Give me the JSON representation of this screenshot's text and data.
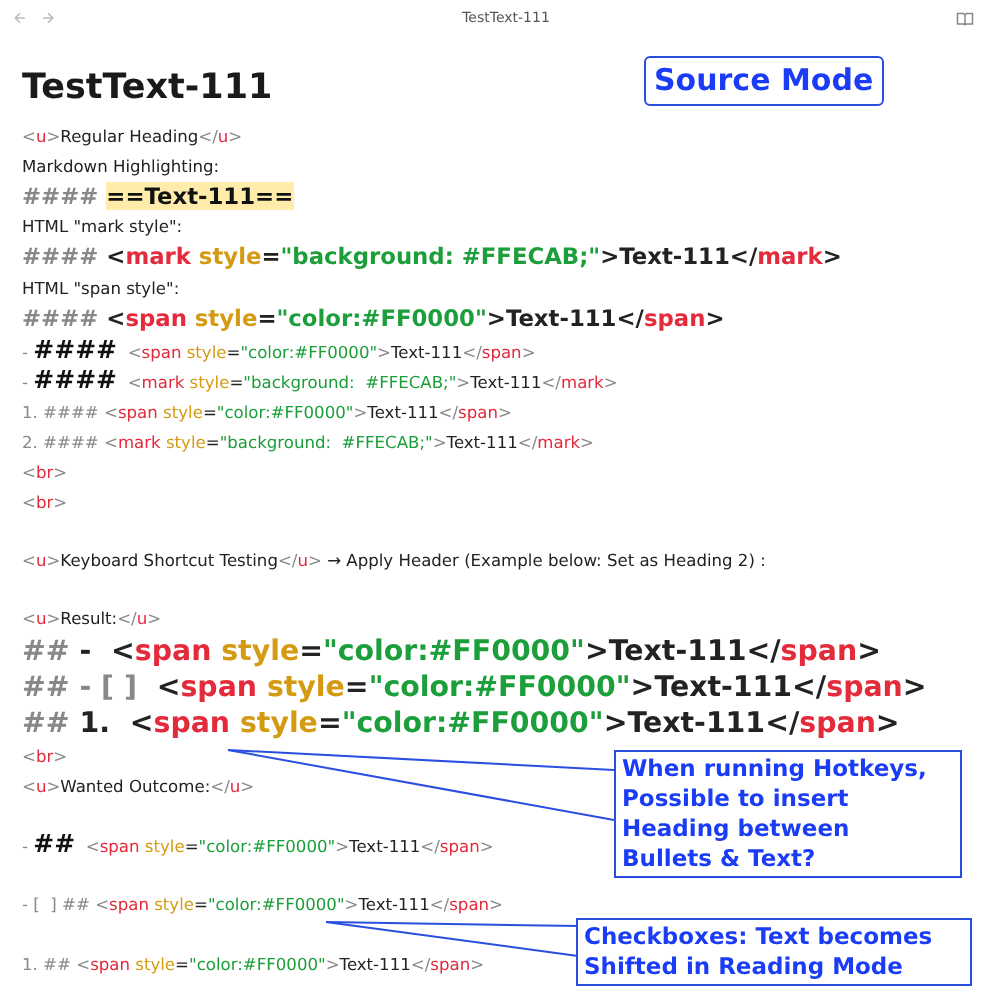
{
  "window": {
    "title": "TestText-111"
  },
  "document": {
    "title": "TestText-111",
    "lines": [
      {
        "kind": "body",
        "space_before": false,
        "tokens": [
          {
            "kind": "punct",
            "text": "<"
          },
          {
            "kind": "tag",
            "text": "u"
          },
          {
            "kind": "punct",
            "text": ">"
          },
          {
            "kind": "text",
            "text": "Regular Heading"
          },
          {
            "kind": "punct",
            "text": "</"
          },
          {
            "kind": "tag",
            "text": "u"
          },
          {
            "kind": "punct",
            "text": ">"
          }
        ]
      },
      {
        "kind": "body",
        "space_before": false,
        "tokens": [
          {
            "kind": "text",
            "text": "Markdown Highlighting:"
          }
        ]
      },
      {
        "kind": "h4",
        "space_before": false,
        "tokens": [
          {
            "kind": "hash",
            "text": "#### "
          },
          {
            "kind": "highlight",
            "text": "==Text-111=="
          }
        ]
      },
      {
        "kind": "body",
        "space_before": false,
        "tokens": [
          {
            "kind": "text",
            "text": "HTML \"mark style\":"
          }
        ]
      },
      {
        "kind": "h4",
        "space_before": false,
        "tokens": [
          {
            "kind": "hash",
            "text": "#### "
          },
          {
            "kind": "punct",
            "text": "<"
          },
          {
            "kind": "tag",
            "text": "mark"
          },
          {
            "kind": "attr",
            "text": " style"
          },
          {
            "kind": "text",
            "text": "="
          },
          {
            "kind": "str",
            "text": "\"background: #FFECAB;\""
          },
          {
            "kind": "punct",
            "text": ">"
          },
          {
            "kind": "text",
            "text": "Text-111"
          },
          {
            "kind": "punct",
            "text": "</"
          },
          {
            "kind": "tag",
            "text": "mark"
          },
          {
            "kind": "punct",
            "text": ">"
          }
        ]
      },
      {
        "kind": "body",
        "space_before": false,
        "tokens": [
          {
            "kind": "text",
            "text": "HTML \"span style\":"
          }
        ]
      },
      {
        "kind": "h4",
        "space_before": false,
        "tokens": [
          {
            "kind": "hash",
            "text": "#### "
          },
          {
            "kind": "punct",
            "text": "<"
          },
          {
            "kind": "tag",
            "text": "span"
          },
          {
            "kind": "attr",
            "text": " style"
          },
          {
            "kind": "text",
            "text": "="
          },
          {
            "kind": "str",
            "text": "\"color:#FF0000\""
          },
          {
            "kind": "punct",
            "text": ">"
          },
          {
            "kind": "text",
            "text": "Text-111"
          },
          {
            "kind": "punct",
            "text": "</"
          },
          {
            "kind": "tag",
            "text": "span"
          },
          {
            "kind": "punct",
            "text": ">"
          }
        ]
      },
      {
        "kind": "body",
        "space_before": false,
        "tokens": [
          {
            "kind": "hash",
            "text": "- "
          },
          {
            "kind": "strong",
            "text": "####"
          },
          {
            "kind": "punct",
            "text": "  <"
          },
          {
            "kind": "tag",
            "text": "span"
          },
          {
            "kind": "attr",
            "text": " style"
          },
          {
            "kind": "text",
            "text": "="
          },
          {
            "kind": "str",
            "text": "\"color:#FF0000\""
          },
          {
            "kind": "punct",
            "text": ">"
          },
          {
            "kind": "text",
            "text": "Text-111"
          },
          {
            "kind": "punct",
            "text": "</"
          },
          {
            "kind": "tag",
            "text": "span"
          },
          {
            "kind": "punct",
            "text": ">"
          }
        ]
      },
      {
        "kind": "body",
        "space_before": false,
        "tokens": [
          {
            "kind": "hash",
            "text": "- "
          },
          {
            "kind": "strong",
            "text": "####"
          },
          {
            "kind": "punct",
            "text": "  <"
          },
          {
            "kind": "tag",
            "text": "mark"
          },
          {
            "kind": "attr",
            "text": " style"
          },
          {
            "kind": "text",
            "text": "="
          },
          {
            "kind": "str",
            "text": "\"background:  #FFECAB;\""
          },
          {
            "kind": "punct",
            "text": ">"
          },
          {
            "kind": "text",
            "text": "Text-111"
          },
          {
            "kind": "punct",
            "text": "</"
          },
          {
            "kind": "tag",
            "text": "mark"
          },
          {
            "kind": "punct",
            "text": ">"
          }
        ]
      },
      {
        "kind": "body",
        "space_before": false,
        "tokens": [
          {
            "kind": "hash",
            "text": "1. #### "
          },
          {
            "kind": "punct",
            "text": "<"
          },
          {
            "kind": "tag",
            "text": "span"
          },
          {
            "kind": "attr",
            "text": " style"
          },
          {
            "kind": "text",
            "text": "="
          },
          {
            "kind": "str",
            "text": "\"color:#FF0000\""
          },
          {
            "kind": "punct",
            "text": ">"
          },
          {
            "kind": "text",
            "text": "Text-111"
          },
          {
            "kind": "punct",
            "text": "</"
          },
          {
            "kind": "tag",
            "text": "span"
          },
          {
            "kind": "punct",
            "text": ">"
          }
        ]
      },
      {
        "kind": "body",
        "space_before": false,
        "tokens": [
          {
            "kind": "hash",
            "text": "2. #### "
          },
          {
            "kind": "punct",
            "text": "<"
          },
          {
            "kind": "tag",
            "text": "mark"
          },
          {
            "kind": "attr",
            "text": " style"
          },
          {
            "kind": "text",
            "text": "="
          },
          {
            "kind": "str",
            "text": "\"background:  #FFECAB;\""
          },
          {
            "kind": "punct",
            "text": ">"
          },
          {
            "kind": "text",
            "text": "Text-111"
          },
          {
            "kind": "punct",
            "text": "</"
          },
          {
            "kind": "tag",
            "text": "mark"
          },
          {
            "kind": "punct",
            "text": ">"
          }
        ]
      },
      {
        "kind": "body",
        "space_before": false,
        "tokens": [
          {
            "kind": "punct",
            "text": "<"
          },
          {
            "kind": "tag",
            "text": "br"
          },
          {
            "kind": "punct",
            "text": ">"
          }
        ]
      },
      {
        "kind": "body",
        "space_before": false,
        "tokens": [
          {
            "kind": "punct",
            "text": "<"
          },
          {
            "kind": "tag",
            "text": "br"
          },
          {
            "kind": "punct",
            "text": ">"
          }
        ]
      },
      {
        "kind": "body",
        "space_before": true,
        "tokens": [
          {
            "kind": "punct",
            "text": "<"
          },
          {
            "kind": "tag",
            "text": "u"
          },
          {
            "kind": "punct",
            "text": ">"
          },
          {
            "kind": "text",
            "text": "Keyboard Shortcut Testing"
          },
          {
            "kind": "punct",
            "text": "</"
          },
          {
            "kind": "tag",
            "text": "u"
          },
          {
            "kind": "punct",
            "text": ">"
          },
          {
            "kind": "text",
            "text": " → Apply Header (Example below: Set as Heading 2) :"
          }
        ]
      },
      {
        "kind": "body",
        "space_before": true,
        "tokens": [
          {
            "kind": "punct",
            "text": "<"
          },
          {
            "kind": "tag",
            "text": "u"
          },
          {
            "kind": "punct",
            "text": ">"
          },
          {
            "kind": "text",
            "text": "Result:"
          },
          {
            "kind": "punct",
            "text": "</"
          },
          {
            "kind": "tag",
            "text": "u"
          },
          {
            "kind": "punct",
            "text": ">"
          }
        ]
      },
      {
        "kind": "h2",
        "space_before": false,
        "tokens": [
          {
            "kind": "hash",
            "text": "## "
          },
          {
            "kind": "text",
            "text": "-  "
          },
          {
            "kind": "punct",
            "text": "<"
          },
          {
            "kind": "tag",
            "text": "span"
          },
          {
            "kind": "attr",
            "text": " style"
          },
          {
            "kind": "text",
            "text": "="
          },
          {
            "kind": "str",
            "text": "\"color:#FF0000\""
          },
          {
            "kind": "punct",
            "text": ">"
          },
          {
            "kind": "text",
            "text": "Text-111"
          },
          {
            "kind": "punct",
            "text": "</"
          },
          {
            "kind": "tag",
            "text": "span"
          },
          {
            "kind": "punct",
            "text": ">"
          }
        ]
      },
      {
        "kind": "h2",
        "space_before": false,
        "tokens": [
          {
            "kind": "hash",
            "text": "## - [ ]  "
          },
          {
            "kind": "punct",
            "text": "<"
          },
          {
            "kind": "tag",
            "text": "span"
          },
          {
            "kind": "attr",
            "text": " style"
          },
          {
            "kind": "text",
            "text": "="
          },
          {
            "kind": "str",
            "text": "\"color:#FF0000\""
          },
          {
            "kind": "punct",
            "text": ">"
          },
          {
            "kind": "text",
            "text": "Text-111"
          },
          {
            "kind": "punct",
            "text": "</"
          },
          {
            "kind": "tag",
            "text": "span"
          },
          {
            "kind": "punct",
            "text": ">"
          }
        ]
      },
      {
        "kind": "h2",
        "space_before": false,
        "tokens": [
          {
            "kind": "hash",
            "text": "## "
          },
          {
            "kind": "text",
            "text": "1.  "
          },
          {
            "kind": "punct",
            "text": "<"
          },
          {
            "kind": "tag",
            "text": "span"
          },
          {
            "kind": "attr",
            "text": " style"
          },
          {
            "kind": "text",
            "text": "="
          },
          {
            "kind": "str",
            "text": "\"color:#FF0000\""
          },
          {
            "kind": "punct",
            "text": ">"
          },
          {
            "kind": "text",
            "text": "Text-111"
          },
          {
            "kind": "punct",
            "text": "</"
          },
          {
            "kind": "tag",
            "text": "span"
          },
          {
            "kind": "punct",
            "text": ">"
          }
        ]
      },
      {
        "kind": "body",
        "space_before": false,
        "tokens": [
          {
            "kind": "punct",
            "text": "<"
          },
          {
            "kind": "tag",
            "text": "br"
          },
          {
            "kind": "punct",
            "text": ">"
          }
        ]
      },
      {
        "kind": "body",
        "space_before": false,
        "tokens": [
          {
            "kind": "punct",
            "text": "<"
          },
          {
            "kind": "tag",
            "text": "u"
          },
          {
            "kind": "punct",
            "text": ">"
          },
          {
            "kind": "text",
            "text": "Wanted Outcome:"
          },
          {
            "kind": "punct",
            "text": "</"
          },
          {
            "kind": "tag",
            "text": "u"
          },
          {
            "kind": "punct",
            "text": ">"
          }
        ]
      },
      {
        "kind": "body",
        "space_before": true,
        "tokens": [
          {
            "kind": "hash",
            "text": "- "
          },
          {
            "kind": "strong",
            "text": "##"
          },
          {
            "kind": "punct",
            "text": "  <"
          },
          {
            "kind": "tag",
            "text": "span"
          },
          {
            "kind": "attr",
            "text": " style"
          },
          {
            "kind": "text",
            "text": "="
          },
          {
            "kind": "str",
            "text": "\"color:#FF0000\""
          },
          {
            "kind": "punct",
            "text": ">"
          },
          {
            "kind": "text",
            "text": "Text-111"
          },
          {
            "kind": "punct",
            "text": "</"
          },
          {
            "kind": "tag",
            "text": "span"
          },
          {
            "kind": "punct",
            "text": ">"
          }
        ]
      },
      {
        "kind": "body",
        "space_before": true,
        "tokens": [
          {
            "kind": "hash",
            "text": "- [  ] ## "
          },
          {
            "kind": "punct",
            "text": "<"
          },
          {
            "kind": "tag",
            "text": "span"
          },
          {
            "kind": "attr",
            "text": " style"
          },
          {
            "kind": "text",
            "text": "="
          },
          {
            "kind": "str",
            "text": "\"color:#FF0000\""
          },
          {
            "kind": "punct",
            "text": ">"
          },
          {
            "kind": "text",
            "text": "Text-111"
          },
          {
            "kind": "punct",
            "text": "</"
          },
          {
            "kind": "tag",
            "text": "span"
          },
          {
            "kind": "punct",
            "text": ">"
          }
        ]
      },
      {
        "kind": "body",
        "space_before": true,
        "tokens": [
          {
            "kind": "hash",
            "text": "1. ## "
          },
          {
            "kind": "punct",
            "text": "<"
          },
          {
            "kind": "tag",
            "text": "span"
          },
          {
            "kind": "attr",
            "text": " style"
          },
          {
            "kind": "text",
            "text": "="
          },
          {
            "kind": "str",
            "text": "\"color:#FF0000\""
          },
          {
            "kind": "punct",
            "text": ">"
          },
          {
            "kind": "text",
            "text": "Text-111"
          },
          {
            "kind": "punct",
            "text": "</"
          },
          {
            "kind": "tag",
            "text": "span"
          },
          {
            "kind": "punct",
            "text": ">"
          }
        ]
      }
    ]
  },
  "annotations": [
    {
      "kind": "label",
      "text": "Source Mode"
    },
    {
      "kind": "callout",
      "text": "When running Hotkeys,\nPossible to insert\nHeading between\nBullets & Text?"
    },
    {
      "kind": "callout",
      "text": "Checkboxes: Text becomes\nShifted in Reading Mode"
    }
  ]
}
